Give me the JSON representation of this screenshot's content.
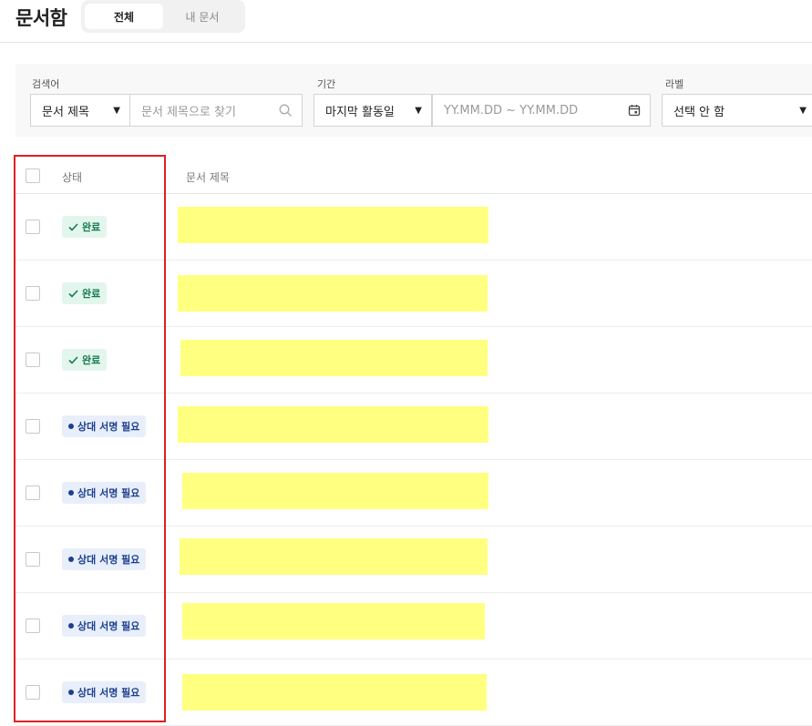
{
  "header": {
    "title": "문서함",
    "tabs": [
      {
        "label": "전체",
        "active": true
      },
      {
        "label": "내 문서",
        "active": false
      }
    ]
  },
  "filters": {
    "search": {
      "label": "검색어",
      "scope_value": "문서 제목",
      "placeholder": "문서 제목으로 찾기"
    },
    "period": {
      "label": "기간",
      "type_value": "마지막 활동일",
      "range_placeholder": "YY.MM.DD ~ YY.MM.DD"
    },
    "label_filter": {
      "label": "라벨",
      "value": "선택 안 함"
    }
  },
  "table": {
    "columns": [
      "상태",
      "문서 제목"
    ],
    "rows": [
      {
        "status": "완료",
        "status_type": "done"
      },
      {
        "status": "완료",
        "status_type": "done"
      },
      {
        "status": "완료",
        "status_type": "done"
      },
      {
        "status": "상대 서명 필요",
        "status_type": "need"
      },
      {
        "status": "상대 서명 필요",
        "status_type": "need"
      },
      {
        "status": "상대 서명 필요",
        "status_type": "need"
      },
      {
        "status": "상대 서명 필요",
        "status_type": "need"
      },
      {
        "status": "상대 서명 필요",
        "status_type": "need"
      }
    ]
  },
  "colors": {
    "highlight": "#e02020",
    "redaction": "#ffff80",
    "done_bg": "#e3f6ee",
    "done_fg": "#147a4e",
    "need_bg": "#e8effb",
    "need_fg": "#1d3f8f"
  },
  "icons": {
    "search": "search-icon",
    "calendar": "calendar-icon",
    "dropdown": "caret-down-icon",
    "done": "check-icon",
    "need": "dot-icon"
  }
}
